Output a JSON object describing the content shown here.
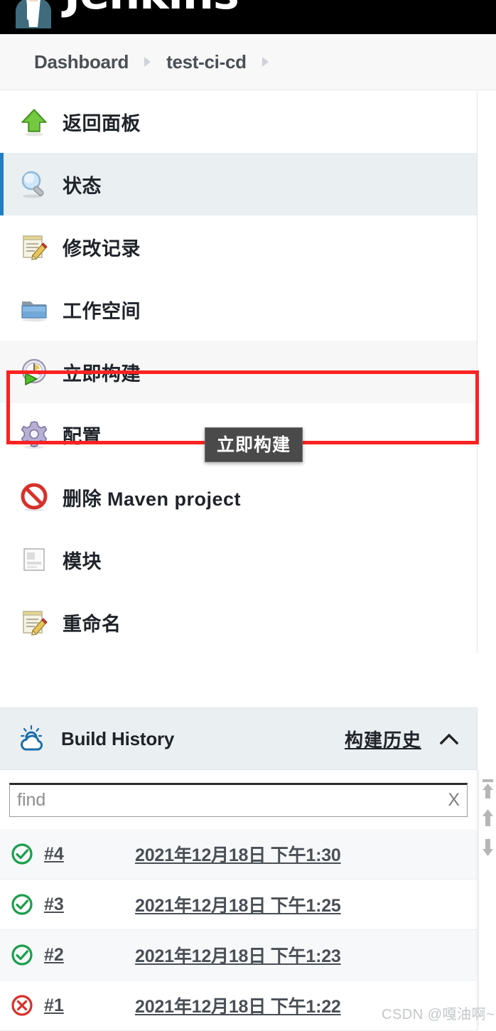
{
  "header": {
    "brand": "Jenkins",
    "breadcrumbs": [
      {
        "label": "Dashboard"
      },
      {
        "label": "test-ci-cd"
      }
    ]
  },
  "sidebar": {
    "items": [
      {
        "label": "返回面板",
        "icon": "up-arrow-green-icon",
        "name": "back-to-dashboard",
        "state": "normal"
      },
      {
        "label": "状态",
        "icon": "magnifier-icon",
        "name": "status",
        "state": "selected"
      },
      {
        "label": "修改记录",
        "icon": "notepad-pencil-icon",
        "name": "changes",
        "state": "normal"
      },
      {
        "label": "工作空间",
        "icon": "folder-blue-icon",
        "name": "workspace",
        "state": "normal"
      },
      {
        "label": "立即构建",
        "icon": "build-clock-play-icon",
        "name": "build-now",
        "state": "hovered"
      },
      {
        "label": "配置",
        "icon": "gear-purple-icon",
        "name": "configure",
        "state": "normal"
      },
      {
        "label": "删除 Maven project",
        "icon": "delete-forbidden-icon",
        "name": "delete-project",
        "state": "normal"
      },
      {
        "label": "模块",
        "icon": "modules-page-icon",
        "name": "modules",
        "state": "normal"
      },
      {
        "label": "重命名",
        "icon": "notepad-pencil-icon",
        "name": "rename",
        "state": "normal"
      }
    ]
  },
  "tooltip": {
    "text": "立即构建"
  },
  "build_history": {
    "icon": "weather-sun-cloud-icon",
    "title": "Build History",
    "link_label": "构建历史",
    "collapse_icon": "chevron-up-icon",
    "find": {
      "value": "",
      "placeholder": "find",
      "clear_label": "X"
    },
    "rows": [
      {
        "number": "#4",
        "date": "2021年12月18日 下午1:30",
        "status": "success"
      },
      {
        "number": "#3",
        "date": "2021年12月18日 下午1:25",
        "status": "success"
      },
      {
        "number": "#2",
        "date": "2021年12月18日 下午1:23",
        "status": "success"
      },
      {
        "number": "#1",
        "date": "2021年12月18日 下午1:22",
        "status": "failed"
      }
    ]
  },
  "scroll_rail": {
    "buttons": [
      {
        "name": "scroll-to-top-icon"
      },
      {
        "name": "scroll-up-icon"
      },
      {
        "name": "scroll-down-icon"
      }
    ]
  },
  "annotation": {
    "target": "立即构建"
  },
  "watermark": {
    "text": "CSDN @嘎油啊~"
  },
  "colors": {
    "accent_blue": "#1f7ec4",
    "selected_bg": "#eaeff2",
    "annotation_red": "#fc2222",
    "success_green": "#1a9e4b",
    "failure_red": "#d9302a",
    "topbar_black": "#000000"
  }
}
